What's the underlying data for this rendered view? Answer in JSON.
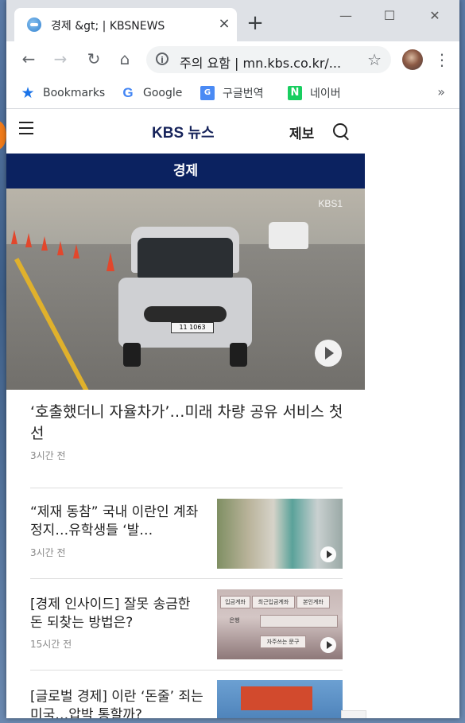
{
  "browser": {
    "tab_title": "경제 &gt; | KBSNEWS",
    "tab_close": "×",
    "new_tab": "+",
    "window_minimize": "—",
    "window_maximize": "☐",
    "window_close": "✕",
    "back": "←",
    "forward": "→",
    "reload": "↻",
    "home": "⌂",
    "omnibox_text": "주의 요함  |  mn.kbs.co.kr/...",
    "omnibox_info": "i",
    "bookmark_star": "☆",
    "menu": "⋮",
    "bookmarks": [
      {
        "label": "Bookmarks",
        "icon": "★"
      },
      {
        "label": "Google",
        "icon": "G"
      },
      {
        "label": "구글번역",
        "icon": "G"
      },
      {
        "label": "네이버",
        "icon": "N"
      }
    ],
    "bookmarks_more": "»"
  },
  "site": {
    "logo_kbs": "KBS",
    "logo_news": "뉴스",
    "report_label": "제보",
    "section_title": "경제",
    "hero_watermark": "KBS1",
    "hero_plate": "11 1063"
  },
  "articles": {
    "headline": {
      "title": "‘호출했더니 자율차가’…미래 차량 공유 서비스 첫선",
      "time": "3시간 전"
    },
    "items": [
      {
        "title": "“제재 동참” 국내 이란인 계좌 정지…유학생들 ‘발…",
        "time": "3시간 전"
      },
      {
        "title": "[경제 인사이드] 잘못 송금한 돈 되찾는 방법은?",
        "time": "15시간 전"
      },
      {
        "title": "[글로벌 경제] 이란 ‘돈줄’ 죄는 미국…압박 통할까?",
        "time": ""
      }
    ]
  },
  "thumb_labels": [
    "입금계좌",
    "최근입금계좌",
    "본인계좌",
    "은행",
    "자주쓰는 문구"
  ],
  "colors": {
    "section_bar": "#0b2260",
    "logo": "#16235a",
    "naver_green": "#19ce60"
  }
}
